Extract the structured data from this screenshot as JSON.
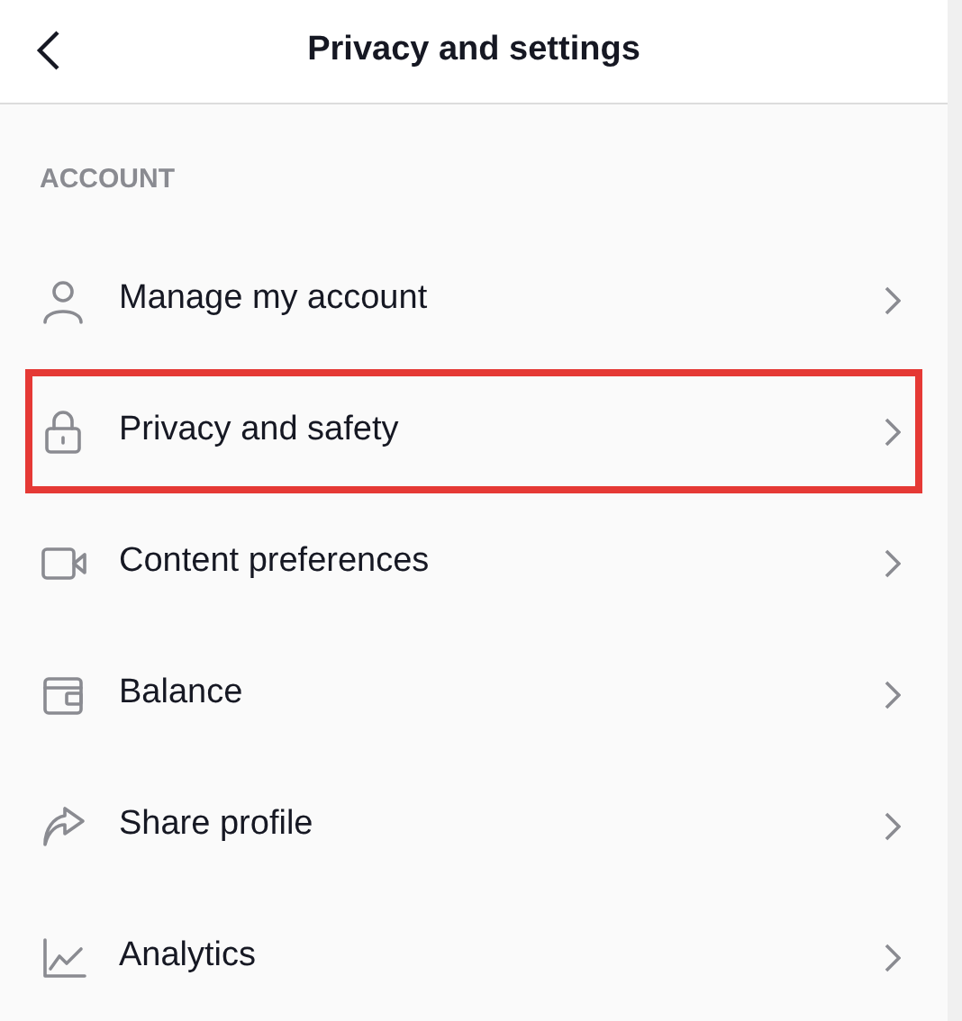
{
  "header": {
    "title": "Privacy and settings"
  },
  "section": {
    "label": "ACCOUNT"
  },
  "items": [
    {
      "label": "Manage my account",
      "kind": "person",
      "highlighted": false
    },
    {
      "label": "Privacy and safety",
      "kind": "lock",
      "highlighted": true
    },
    {
      "label": "Content preferences",
      "kind": "video",
      "highlighted": false
    },
    {
      "label": "Balance",
      "kind": "wallet",
      "highlighted": false
    },
    {
      "label": "Share profile",
      "kind": "share",
      "highlighted": false
    },
    {
      "label": "Analytics",
      "kind": "chart",
      "highlighted": false
    }
  ]
}
